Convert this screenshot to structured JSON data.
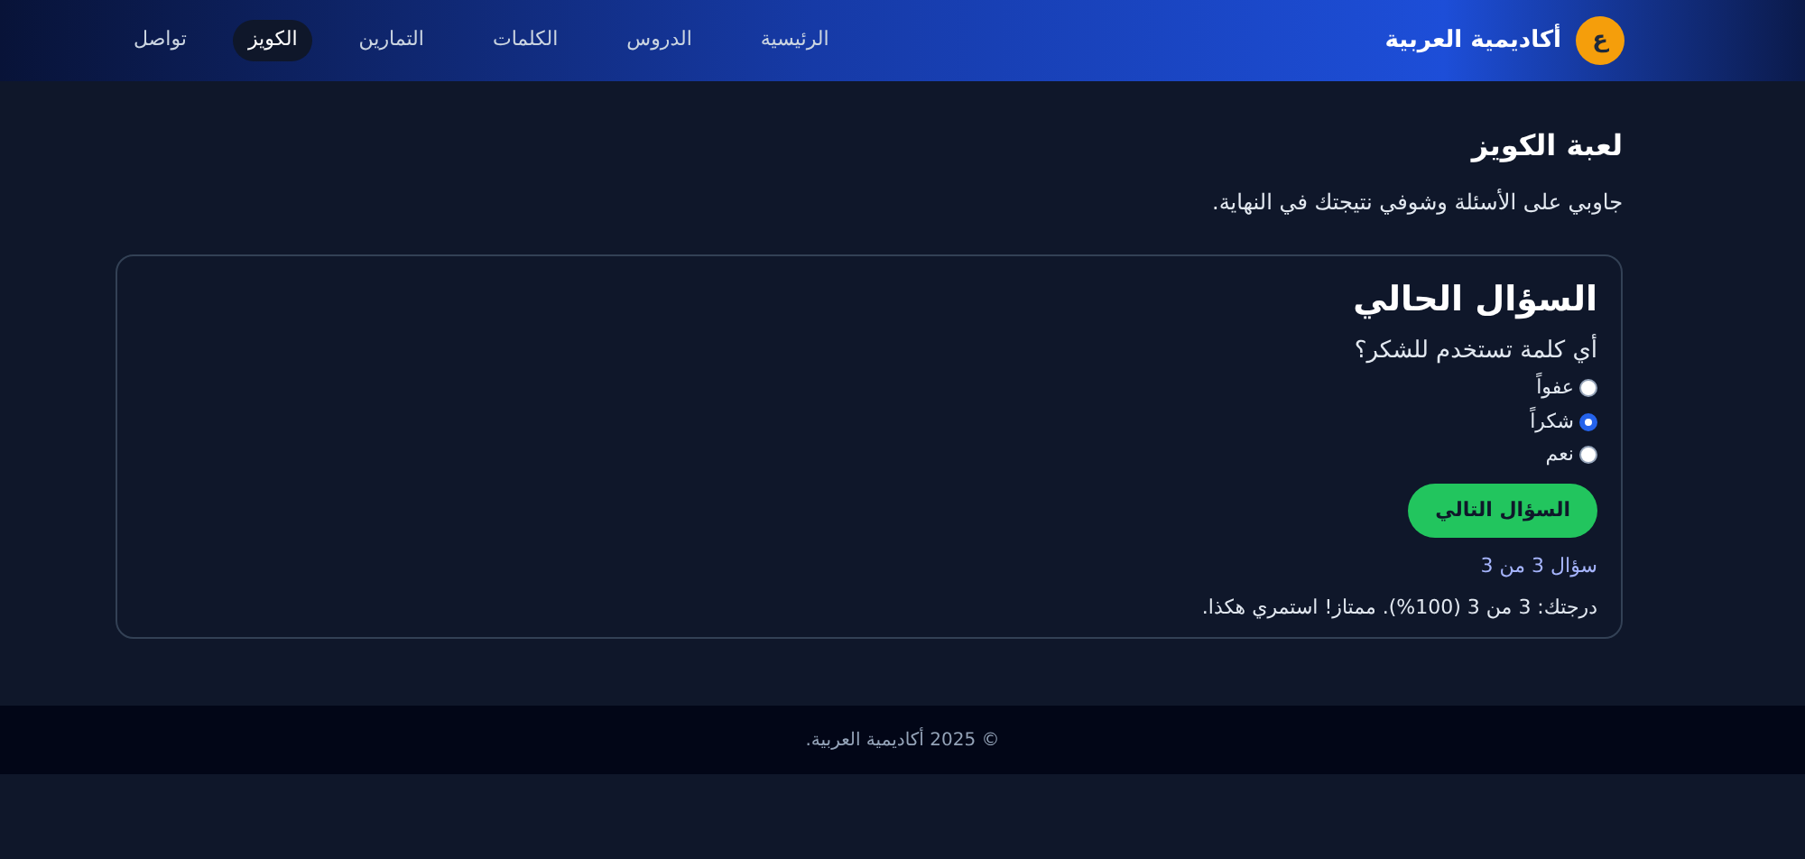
{
  "header": {
    "logo_letter": "ع",
    "site_name": "أكاديمية العربية",
    "nav": [
      {
        "label": "الرئيسية",
        "selected": false
      },
      {
        "label": "الدروس",
        "selected": false
      },
      {
        "label": "الكلمات",
        "selected": false
      },
      {
        "label": "التمارين",
        "selected": false
      },
      {
        "label": "الكويز",
        "selected": true
      },
      {
        "label": "تواصل",
        "selected": false
      }
    ]
  },
  "page": {
    "title": "لعبة الكويز",
    "description": "جاوبي على الأسئلة وشوفي نتيجتك في النهاية."
  },
  "quiz": {
    "heading": "السؤال الحالي",
    "question": "أي كلمة تستخدم للشكر؟",
    "options": [
      {
        "label": "عفواً",
        "selected": false
      },
      {
        "label": "شكراً",
        "selected": true
      },
      {
        "label": "نعم",
        "selected": false
      }
    ],
    "next_button": "السؤال التالي",
    "progress": "سؤال 3 من 3",
    "score": "درجتك: 3 من 3 (100%). ممتاز! استمري هكذا."
  },
  "footer": {
    "copyright": "© 2025 أكاديمية العربية."
  }
}
